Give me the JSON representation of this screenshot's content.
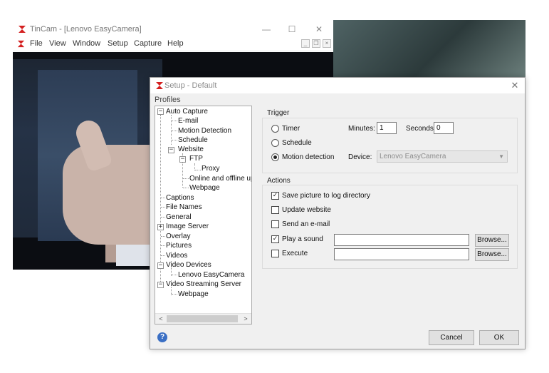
{
  "main_window": {
    "title": "TinCam - [Lenovo EasyCamera]",
    "controls": {
      "minimize": "—",
      "maximize": "☐",
      "close": "✕"
    },
    "menu": [
      "File",
      "View",
      "Window",
      "Setup",
      "Capture",
      "Help"
    ],
    "mdi_controls": {
      "minimize": "_",
      "restore": "❐",
      "close": "×"
    }
  },
  "setup": {
    "title": "Setup - Default",
    "close": "✕",
    "profiles_label": "Profiles",
    "tree": {
      "auto_capture": "Auto Capture",
      "email": "E-mail",
      "motion_detection": "Motion Detection",
      "schedule": "Schedule",
      "website": "Website",
      "ftp": "FTP",
      "proxy": "Proxy",
      "online_offline": "Online and offline uplc",
      "webpage": "Webpage",
      "captions": "Captions",
      "file_names": "File Names",
      "general": "General",
      "image_server": "Image Server",
      "overlay": "Overlay",
      "pictures": "Pictures",
      "videos": "Videos",
      "video_devices": "Video Devices",
      "lenovo_camera": "Lenovo EasyCamera",
      "video_streaming": "Video Streaming Server",
      "webpage2": "Webpage"
    },
    "trigger": {
      "label": "Trigger",
      "timer": "Timer",
      "schedule": "Schedule",
      "motion_detection": "Motion detection",
      "minutes_label": "Minutes:",
      "minutes_value": "1",
      "seconds_label": "Seconds:",
      "seconds_value": "0",
      "device_label": "Device:",
      "device_value": "Lenovo EasyCamera",
      "selected": "motion_detection"
    },
    "actions": {
      "label": "Actions",
      "save_picture": "Save picture to log directory",
      "update_website": "Update website",
      "send_email": "Send an e-mail",
      "play_sound": "Play a sound",
      "execute": "Execute",
      "browse": "Browse...",
      "checked_mark": "✓"
    },
    "help_icon": "?",
    "cancel": "Cancel",
    "ok": "OK"
  }
}
